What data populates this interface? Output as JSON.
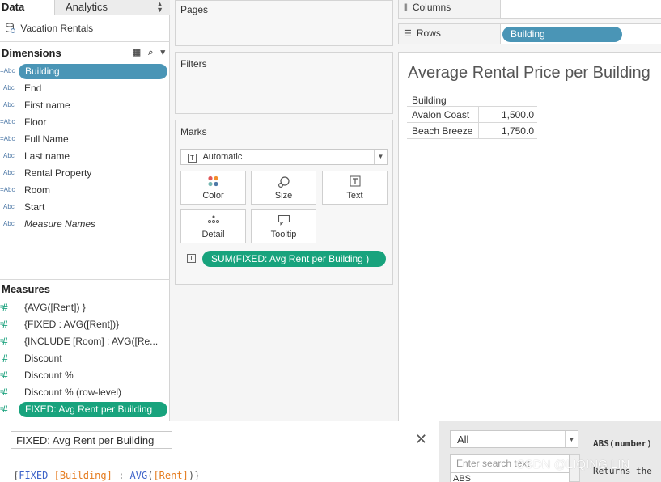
{
  "left_pane": {
    "tab_data": "Data",
    "tab_analytics": "Analytics",
    "datasource": "Vacation Rentals",
    "dimensions_title": "Dimensions",
    "dimensions": [
      {
        "type": "=Abc",
        "label": "Building",
        "selected": true
      },
      {
        "type": "Abc",
        "label": "End"
      },
      {
        "type": "Abc",
        "label": "First name"
      },
      {
        "type": "=Abc",
        "label": "Floor"
      },
      {
        "type": "=Abc",
        "label": "Full Name"
      },
      {
        "type": "Abc",
        "label": "Last name"
      },
      {
        "type": "Abc",
        "label": "Rental Property"
      },
      {
        "type": "=Abc",
        "label": "Room"
      },
      {
        "type": "Abc",
        "label": "Start"
      },
      {
        "type": "Abc",
        "label": "Measure Names"
      }
    ],
    "measures_title": "Measures",
    "measures": [
      {
        "label": "{AVG([Rent]) }"
      },
      {
        "label": "{FIXED : AVG([Rent])}"
      },
      {
        "label": "{INCLUDE [Room] : AVG([Re..."
      },
      {
        "label": "Discount"
      },
      {
        "label": "Discount %"
      },
      {
        "label": "Discount % (row-level)"
      },
      {
        "label": "FIXED: Avg Rent per Building",
        "selected": true
      }
    ]
  },
  "shelves": {
    "pages": "Pages",
    "filters": "Filters",
    "marks": "Marks",
    "mark_type": "Automatic",
    "mark_buttons": {
      "color": "Color",
      "size": "Size",
      "text": "Text",
      "detail": "Detail",
      "tooltip": "Tooltip"
    },
    "marks_pill": "SUM(FIXED: Avg Rent per Building  )",
    "columns_label": "Columns",
    "rows_label": "Rows",
    "rows_pill": "Building"
  },
  "viz": {
    "title": "Average Rental Price per Building",
    "header": "Building",
    "rows": [
      {
        "name": "Avalon Coast",
        "value": "1,500.0"
      },
      {
        "name": "Beach Breeze",
        "value": "1,750.0"
      }
    ]
  },
  "calc_editor": {
    "name": "FIXED: Avg Rent per Building",
    "close": "✕",
    "code": {
      "open": "{",
      "fixed": "FIXED",
      "field1": "[Building]",
      "colon": " : ",
      "avg": "AVG",
      "paren_open": "(",
      "field2": "[Rent]",
      "paren_close": ")",
      "close": "}"
    }
  },
  "function_ref": {
    "filter": "All",
    "search_placeholder": "Enter search text",
    "first_item": "ABS",
    "signature": "ABS(number)",
    "description": "Returns the"
  },
  "watermark": "CSDN @LIQING LIN",
  "colors": {
    "dimension_pill": "#4a95b6",
    "measure_pill": "#18a37d",
    "calc_keyword": "#3d63c9",
    "calc_field": "#e57c1f"
  }
}
